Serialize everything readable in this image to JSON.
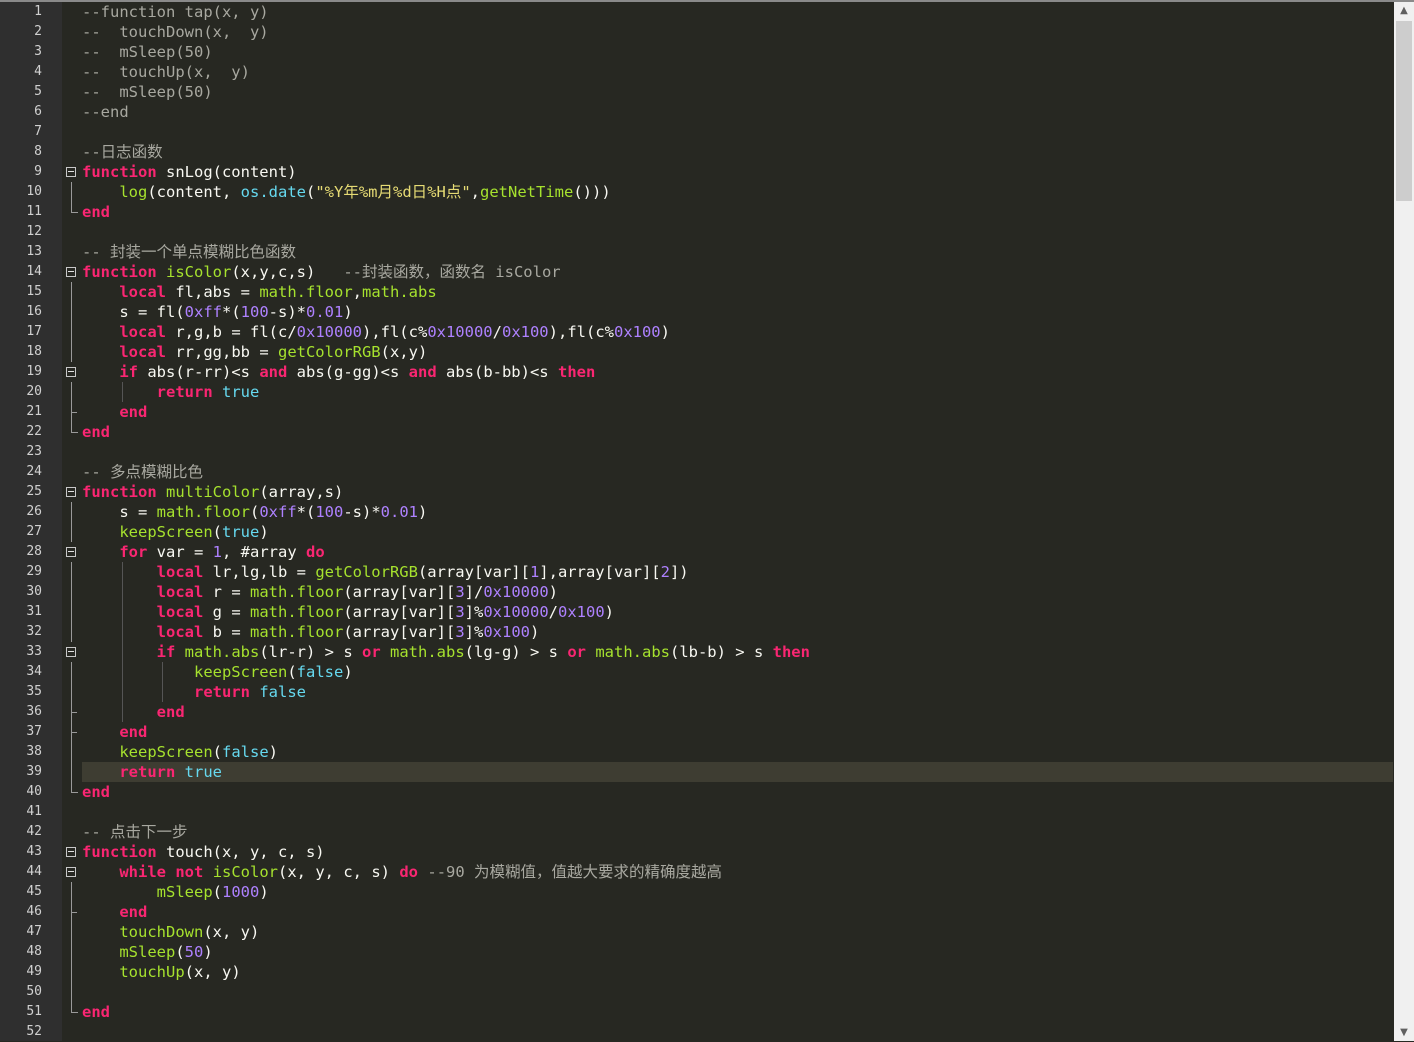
{
  "scrollbar": {
    "up_arrow": "▲",
    "down_arrow": "▼"
  },
  "current_line": 39,
  "lines": [
    {
      "n": "1",
      "tokens": [
        [
          "cm",
          "--function tap(x, y)"
        ]
      ]
    },
    {
      "n": "2",
      "tokens": [
        [
          "cm",
          "--  touchDown(x,  y)"
        ]
      ]
    },
    {
      "n": "3",
      "tokens": [
        [
          "cm",
          "--  mSleep(50)"
        ]
      ]
    },
    {
      "n": "4",
      "tokens": [
        [
          "cm",
          "--  touchUp(x,  y)"
        ]
      ]
    },
    {
      "n": "5",
      "tokens": [
        [
          "cm",
          "--  mSleep(50)"
        ]
      ]
    },
    {
      "n": "6",
      "tokens": [
        [
          "cm",
          "--end"
        ]
      ]
    },
    {
      "n": "7",
      "tokens": []
    },
    {
      "n": "8",
      "tokens": [
        [
          "cm",
          "--日志函数"
        ]
      ]
    },
    {
      "n": "9",
      "fold": "box",
      "tokens": [
        [
          "kw",
          "function"
        ],
        [
          "op",
          " snLog(content)"
        ]
      ]
    },
    {
      "n": "10",
      "fold": "vert",
      "tokens": [
        [
          "op",
          "    "
        ],
        [
          "fn",
          "log"
        ],
        [
          "op",
          "(content, "
        ],
        [
          "bi",
          "os.date"
        ],
        [
          "op",
          "("
        ],
        [
          "str",
          "\"%Y年%m月%d日%H点\""
        ],
        [
          "op",
          ","
        ],
        [
          "fn",
          "getNetTime"
        ],
        [
          "op",
          "()))"
        ]
      ]
    },
    {
      "n": "11",
      "fold": "end",
      "tokens": [
        [
          "kw",
          "end"
        ]
      ]
    },
    {
      "n": "12",
      "tokens": []
    },
    {
      "n": "13",
      "tokens": [
        [
          "cm",
          "-- 封装一个单点模糊比色函数"
        ]
      ]
    },
    {
      "n": "14",
      "fold": "box",
      "tokens": [
        [
          "kw",
          "function"
        ],
        [
          "op",
          " "
        ],
        [
          "fn",
          "isColor"
        ],
        [
          "op",
          "(x,y,c,s)   "
        ],
        [
          "cm",
          "--封装函数，函数名 isColor"
        ]
      ]
    },
    {
      "n": "15",
      "fold": "vert",
      "tokens": [
        [
          "op",
          "    "
        ],
        [
          "kw",
          "local"
        ],
        [
          "op",
          " fl,abs = "
        ],
        [
          "fn",
          "math.floor"
        ],
        [
          "op",
          ","
        ],
        [
          "fn",
          "math.abs"
        ]
      ]
    },
    {
      "n": "16",
      "fold": "vert",
      "tokens": [
        [
          "op",
          "    s = fl("
        ],
        [
          "num",
          "0xff"
        ],
        [
          "op",
          "*("
        ],
        [
          "num",
          "100"
        ],
        [
          "op",
          "-s)*"
        ],
        [
          "num",
          "0.01"
        ],
        [
          "op",
          ")"
        ]
      ]
    },
    {
      "n": "17",
      "fold": "vert",
      "tokens": [
        [
          "op",
          "    "
        ],
        [
          "kw",
          "local"
        ],
        [
          "op",
          " r,g,b = fl(c/"
        ],
        [
          "num",
          "0x10000"
        ],
        [
          "op",
          "),fl(c%"
        ],
        [
          "num",
          "0x10000"
        ],
        [
          "op",
          "/"
        ],
        [
          "num",
          "0x100"
        ],
        [
          "op",
          "),fl(c%"
        ],
        [
          "num",
          "0x100"
        ],
        [
          "op",
          ")"
        ]
      ]
    },
    {
      "n": "18",
      "fold": "vert",
      "tokens": [
        [
          "op",
          "    "
        ],
        [
          "kw",
          "local"
        ],
        [
          "op",
          " rr,gg,bb = "
        ],
        [
          "fn",
          "getColorRGB"
        ],
        [
          "op",
          "(x,y)"
        ]
      ]
    },
    {
      "n": "19",
      "fold": "box",
      "tokens": [
        [
          "op",
          "    "
        ],
        [
          "kw",
          "if"
        ],
        [
          "op",
          " abs(r-rr)<s "
        ],
        [
          "kw",
          "and"
        ],
        [
          "op",
          " abs(g-gg)<s "
        ],
        [
          "kw",
          "and"
        ],
        [
          "op",
          " abs(b-bb)<s "
        ],
        [
          "kw",
          "then"
        ]
      ]
    },
    {
      "n": "20",
      "fold": "vert",
      "guides": [
        122
      ],
      "tokens": [
        [
          "op",
          "        "
        ],
        [
          "kw",
          "return"
        ],
        [
          "op",
          " "
        ],
        [
          "bi",
          "true"
        ]
      ]
    },
    {
      "n": "21",
      "fold": "tick",
      "tokens": [
        [
          "op",
          "    "
        ],
        [
          "kw",
          "end"
        ]
      ]
    },
    {
      "n": "22",
      "fold": "end",
      "tokens": [
        [
          "kw",
          "end"
        ]
      ]
    },
    {
      "n": "23",
      "tokens": []
    },
    {
      "n": "24",
      "tokens": [
        [
          "cm",
          "-- 多点模糊比色"
        ]
      ]
    },
    {
      "n": "25",
      "fold": "box",
      "tokens": [
        [
          "kw",
          "function"
        ],
        [
          "op",
          " "
        ],
        [
          "fn",
          "multiColor"
        ],
        [
          "op",
          "(array,s)"
        ]
      ]
    },
    {
      "n": "26",
      "fold": "vert",
      "tokens": [
        [
          "op",
          "    s = "
        ],
        [
          "fn",
          "math.floor"
        ],
        [
          "op",
          "("
        ],
        [
          "num",
          "0xff"
        ],
        [
          "op",
          "*("
        ],
        [
          "num",
          "100"
        ],
        [
          "op",
          "-s)*"
        ],
        [
          "num",
          "0.01"
        ],
        [
          "op",
          ")"
        ]
      ]
    },
    {
      "n": "27",
      "fold": "vert",
      "tokens": [
        [
          "op",
          "    "
        ],
        [
          "fn",
          "keepScreen"
        ],
        [
          "op",
          "("
        ],
        [
          "bi",
          "true"
        ],
        [
          "op",
          ")"
        ]
      ]
    },
    {
      "n": "28",
      "fold": "box",
      "tokens": [
        [
          "op",
          "    "
        ],
        [
          "kw",
          "for"
        ],
        [
          "op",
          " var = "
        ],
        [
          "num",
          "1"
        ],
        [
          "op",
          ", #array "
        ],
        [
          "kw",
          "do"
        ]
      ]
    },
    {
      "n": "29",
      "fold": "vert",
      "guides": [
        122
      ],
      "tokens": [
        [
          "op",
          "        "
        ],
        [
          "kw",
          "local"
        ],
        [
          "op",
          " lr,lg,lb = "
        ],
        [
          "fn",
          "getColorRGB"
        ],
        [
          "op",
          "(array[var]["
        ],
        [
          "num",
          "1"
        ],
        [
          "op",
          "],array[var]["
        ],
        [
          "num",
          "2"
        ],
        [
          "op",
          "])"
        ]
      ]
    },
    {
      "n": "30",
      "fold": "vert",
      "guides": [
        122
      ],
      "tokens": [
        [
          "op",
          "        "
        ],
        [
          "kw",
          "local"
        ],
        [
          "op",
          " r = "
        ],
        [
          "fn",
          "math.floor"
        ],
        [
          "op",
          "(array[var]["
        ],
        [
          "num",
          "3"
        ],
        [
          "op",
          "]/"
        ],
        [
          "num",
          "0x10000"
        ],
        [
          "op",
          ")"
        ]
      ]
    },
    {
      "n": "31",
      "fold": "vert",
      "guides": [
        122
      ],
      "tokens": [
        [
          "op",
          "        "
        ],
        [
          "kw",
          "local"
        ],
        [
          "op",
          " g = "
        ],
        [
          "fn",
          "math.floor"
        ],
        [
          "op",
          "(array[var]["
        ],
        [
          "num",
          "3"
        ],
        [
          "op",
          "]%"
        ],
        [
          "num",
          "0x10000"
        ],
        [
          "op",
          "/"
        ],
        [
          "num",
          "0x100"
        ],
        [
          "op",
          ")"
        ]
      ]
    },
    {
      "n": "32",
      "fold": "vert",
      "guides": [
        122
      ],
      "tokens": [
        [
          "op",
          "        "
        ],
        [
          "kw",
          "local"
        ],
        [
          "op",
          " b = "
        ],
        [
          "fn",
          "math.floor"
        ],
        [
          "op",
          "(array[var]["
        ],
        [
          "num",
          "3"
        ],
        [
          "op",
          "]%"
        ],
        [
          "num",
          "0x100"
        ],
        [
          "op",
          ")"
        ]
      ]
    },
    {
      "n": "33",
      "fold": "box",
      "guides": [
        122
      ],
      "tokens": [
        [
          "op",
          "        "
        ],
        [
          "kw",
          "if"
        ],
        [
          "op",
          " "
        ],
        [
          "fn",
          "math.abs"
        ],
        [
          "op",
          "(lr-r) > s "
        ],
        [
          "kw",
          "or"
        ],
        [
          "op",
          " "
        ],
        [
          "fn",
          "math.abs"
        ],
        [
          "op",
          "(lg-g) > s "
        ],
        [
          "kw",
          "or"
        ],
        [
          "op",
          " "
        ],
        [
          "fn",
          "math.abs"
        ],
        [
          "op",
          "(lb-b) > s "
        ],
        [
          "kw",
          "then"
        ]
      ]
    },
    {
      "n": "34",
      "fold": "vert",
      "guides": [
        122,
        162
      ],
      "tokens": [
        [
          "op",
          "            "
        ],
        [
          "fn",
          "keepScreen"
        ],
        [
          "op",
          "("
        ],
        [
          "bi",
          "false"
        ],
        [
          "op",
          ")"
        ]
      ]
    },
    {
      "n": "35",
      "fold": "vert",
      "guides": [
        122,
        162
      ],
      "tokens": [
        [
          "op",
          "            "
        ],
        [
          "kw",
          "return"
        ],
        [
          "op",
          " "
        ],
        [
          "bi",
          "false"
        ]
      ]
    },
    {
      "n": "36",
      "fold": "tick",
      "guides": [
        122
      ],
      "tokens": [
        [
          "op",
          "        "
        ],
        [
          "kw",
          "end"
        ]
      ]
    },
    {
      "n": "37",
      "fold": "tick",
      "tokens": [
        [
          "op",
          "    "
        ],
        [
          "kw",
          "end"
        ]
      ]
    },
    {
      "n": "38",
      "fold": "vert",
      "tokens": [
        [
          "op",
          "    "
        ],
        [
          "fn",
          "keepScreen"
        ],
        [
          "op",
          "("
        ],
        [
          "bi",
          "false"
        ],
        [
          "op",
          ")"
        ]
      ]
    },
    {
      "n": "39",
      "fold": "vert",
      "tokens": [
        [
          "op",
          "    "
        ],
        [
          "kw",
          "return"
        ],
        [
          "op",
          " "
        ],
        [
          "bi",
          "true"
        ]
      ]
    },
    {
      "n": "40",
      "fold": "end",
      "tokens": [
        [
          "kw",
          "end"
        ]
      ]
    },
    {
      "n": "41",
      "tokens": []
    },
    {
      "n": "42",
      "tokens": [
        [
          "cm",
          "-- 点击下一步"
        ]
      ]
    },
    {
      "n": "43",
      "fold": "box",
      "tokens": [
        [
          "kw",
          "function"
        ],
        [
          "op",
          " touch(x, y, c, s)"
        ]
      ]
    },
    {
      "n": "44",
      "fold": "box",
      "tokens": [
        [
          "op",
          "    "
        ],
        [
          "kw",
          "while"
        ],
        [
          "op",
          " "
        ],
        [
          "kw",
          "not"
        ],
        [
          "op",
          " "
        ],
        [
          "fn",
          "isColor"
        ],
        [
          "op",
          "(x, y, c, s) "
        ],
        [
          "kw",
          "do"
        ],
        [
          "op",
          " "
        ],
        [
          "cm",
          "--90 为模糊值，值越大要求的精确度越高"
        ]
      ]
    },
    {
      "n": "45",
      "fold": "vert",
      "tokens": [
        [
          "op",
          "        "
        ],
        [
          "fn",
          "mSleep"
        ],
        [
          "op",
          "("
        ],
        [
          "num",
          "1000"
        ],
        [
          "op",
          ")"
        ]
      ]
    },
    {
      "n": "46",
      "fold": "tick",
      "tokens": [
        [
          "op",
          "    "
        ],
        [
          "kw",
          "end"
        ]
      ]
    },
    {
      "n": "47",
      "fold": "vert",
      "tokens": [
        [
          "op",
          "    "
        ],
        [
          "fn",
          "touchDown"
        ],
        [
          "op",
          "(x, y)"
        ]
      ]
    },
    {
      "n": "48",
      "fold": "vert",
      "tokens": [
        [
          "op",
          "    "
        ],
        [
          "fn",
          "mSleep"
        ],
        [
          "op",
          "("
        ],
        [
          "num",
          "50"
        ],
        [
          "op",
          ")"
        ]
      ]
    },
    {
      "n": "49",
      "fold": "vert",
      "tokens": [
        [
          "op",
          "    "
        ],
        [
          "fn",
          "touchUp"
        ],
        [
          "op",
          "(x, y)"
        ]
      ]
    },
    {
      "n": "50",
      "fold": "vert",
      "tokens": []
    },
    {
      "n": "51",
      "fold": "end",
      "tokens": [
        [
          "kw",
          "end"
        ]
      ]
    },
    {
      "n": "52",
      "tokens": []
    }
  ]
}
